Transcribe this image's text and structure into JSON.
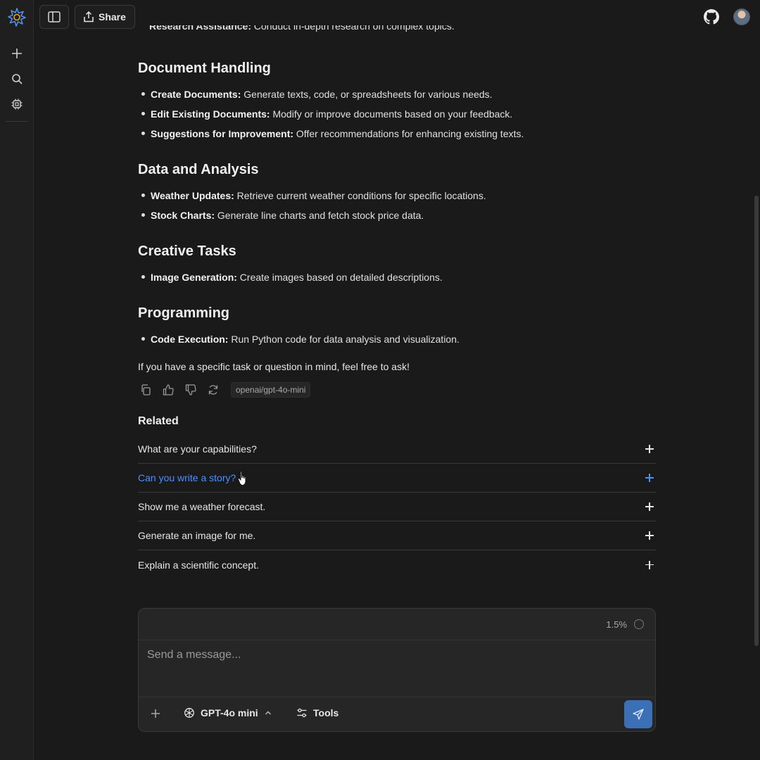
{
  "rail": {
    "logo": "sparkle-logo",
    "items": [
      {
        "name": "new-chat",
        "icon": "plus-icon"
      },
      {
        "name": "search",
        "icon": "search-icon"
      },
      {
        "name": "models",
        "icon": "chip-icon"
      }
    ]
  },
  "topbar": {
    "sidebar_toggle_icon": "sidebar-icon",
    "share_label": "Share",
    "github_icon": "github-icon"
  },
  "content": {
    "clipped_prev_bold": "Research Assistance:",
    "clipped_prev_text": " Conduct in-depth research on complex topics.",
    "sections": [
      {
        "heading": "Document Handling",
        "items": [
          {
            "bold": "Create Documents:",
            "text": " Generate texts, code, or spreadsheets for various needs."
          },
          {
            "bold": "Edit Existing Documents:",
            "text": " Modify or improve documents based on your feedback."
          },
          {
            "bold": "Suggestions for Improvement:",
            "text": " Offer recommendations for enhancing existing texts."
          }
        ]
      },
      {
        "heading": "Data and Analysis",
        "items": [
          {
            "bold": "Weather Updates:",
            "text": " Retrieve current weather conditions for specific locations."
          },
          {
            "bold": "Stock Charts:",
            "text": " Generate line charts and fetch stock price data."
          }
        ]
      },
      {
        "heading": "Creative Tasks",
        "items": [
          {
            "bold": "Image Generation:",
            "text": " Create images based on detailed descriptions."
          }
        ]
      },
      {
        "heading": "Programming",
        "items": [
          {
            "bold": "Code Execution:",
            "text": " Run Python code for data analysis and visualization."
          }
        ]
      }
    ],
    "closing": "If you have a specific task or question in mind, feel free to ask!",
    "model_tag": "openai/gpt-4o-mini"
  },
  "related": {
    "title": "Related",
    "items": [
      "What are your capabilities?",
      "Can you write a story?",
      "Show me a weather forecast.",
      "Generate an image for me.",
      "Explain a scientific concept."
    ],
    "hover_color": "#4a90ff"
  },
  "composer": {
    "context_usage": "1.5%",
    "placeholder": "Send a message...",
    "model_label": "GPT-4o mini",
    "tools_label": "Tools",
    "send_color": "#3b6fb6"
  }
}
